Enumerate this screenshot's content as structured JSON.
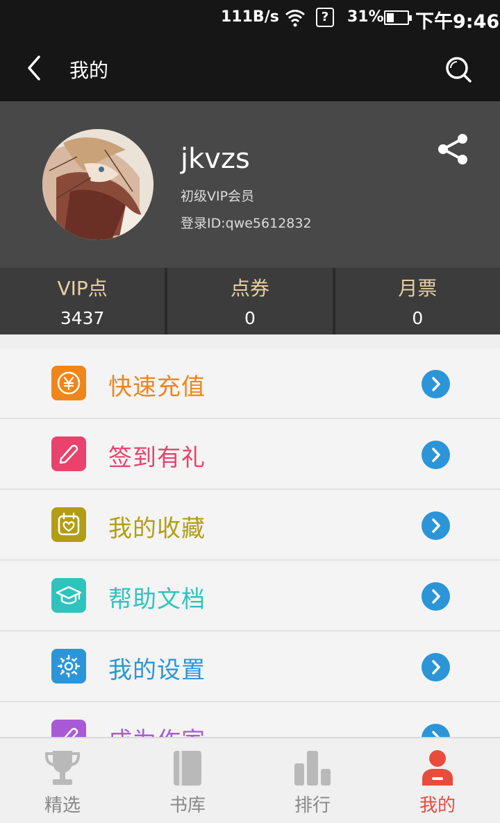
{
  "status_bar": {
    "net_speed": "111B/s",
    "sim": "?",
    "battery_percent": "31%",
    "battery_level": 0.31,
    "time": "下午9:46"
  },
  "header": {
    "title": "我的",
    "back_icon": "chevron-left-icon",
    "search_icon": "search-icon"
  },
  "profile": {
    "username": "jkvzs",
    "level": "初级VIP会员",
    "login_id": "登录ID:qwe5612832",
    "share_icon": "share-icon"
  },
  "stats": [
    {
      "label": "VIP点",
      "value": "3437"
    },
    {
      "label": "点券",
      "value": "0"
    },
    {
      "label": "月票",
      "value": "0"
    }
  ],
  "menu": [
    {
      "label": "快速充值",
      "icon": "yen-coin-icon",
      "color": "#f08519"
    },
    {
      "label": "签到有礼",
      "icon": "pencil-icon",
      "color": "#e9426c"
    },
    {
      "label": "我的收藏",
      "icon": "heart-box-icon",
      "color": "#b39d16"
    },
    {
      "label": "帮助文档",
      "icon": "graduation-cap-icon",
      "color": "#2ec4bd"
    },
    {
      "label": "我的设置",
      "icon": "gear-icon",
      "color": "#2b95d8"
    },
    {
      "label": "成为作家",
      "icon": "edit-icon",
      "color": "#a85ad6"
    }
  ],
  "tabs": [
    {
      "label": "精选",
      "icon": "trophy-icon",
      "active": false
    },
    {
      "label": "书库",
      "icon": "book-icon",
      "active": false
    },
    {
      "label": "排行",
      "icon": "bar-chart-icon",
      "active": false
    },
    {
      "label": "我的",
      "icon": "user-icon",
      "active": true
    }
  ],
  "colors": {
    "header_bg": "#161616",
    "profile_bg": "#484848",
    "stats_label": "#e8cfa6",
    "arrow_bg": "#2b95d8",
    "active_tab": "#e84c3d"
  }
}
